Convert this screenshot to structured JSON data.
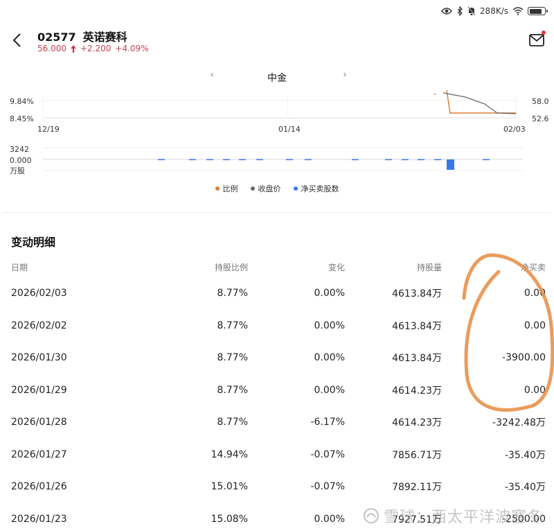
{
  "status_bar": {
    "speed": "288K/s",
    "battery_level": 0.85
  },
  "stock": {
    "code": "02577",
    "name": "英诺赛科",
    "price": "56.000",
    "change": "+2.200",
    "change_pct": "+4.09%"
  },
  "broker": {
    "label": "中金",
    "prev_glyph": "‹",
    "next_glyph": "›"
  },
  "chart": {
    "left_ticks": [
      "9.84%",
      "8.45%"
    ],
    "right_ticks": [
      "58.0",
      "52.6"
    ],
    "x_ticks": [
      "12/19",
      "01/14",
      "02/03"
    ],
    "bar_ticks": [
      "3242",
      "0.000",
      "万股"
    ]
  },
  "chart_data": {
    "type": "line",
    "x": [
      "12/19",
      "01/14",
      "02/03"
    ],
    "series": [
      {
        "name": "比例",
        "color": "#d9803a"
      },
      {
        "name": "收盘价",
        "color": "#666666"
      },
      {
        "name": "净买卖股数",
        "color": "#3b78e7"
      }
    ],
    "left_axis_ticks": [
      "9.84%",
      "8.45%"
    ],
    "right_axis_ticks": [
      "58.0",
      "52.6"
    ],
    "bar_axis_ticks": [
      "3242",
      "0.000"
    ],
    "bar_axis_unit": "万股"
  },
  "legend": [
    {
      "label": "比例",
      "color": "#d9803a"
    },
    {
      "label": "收盘价",
      "color": "#666666"
    },
    {
      "label": "净买卖股数",
      "color": "#3b78e7"
    }
  ],
  "table": {
    "title": "变动明细",
    "headers": {
      "date": "日期",
      "ratio": "持股比例",
      "change": "变化",
      "holding": "持股量",
      "net": "净买卖"
    },
    "rows": [
      {
        "date": "2026/02/03",
        "ratio": "8.77%",
        "change": "0.00%",
        "holding": "4613.84万",
        "net": "0.00"
      },
      {
        "date": "2026/02/02",
        "ratio": "8.77%",
        "change": "0.00%",
        "holding": "4613.84万",
        "net": "0.00"
      },
      {
        "date": "2026/01/30",
        "ratio": "8.77%",
        "change": "0.00%",
        "holding": "4613.84万",
        "net": "-3900.00"
      },
      {
        "date": "2026/01/29",
        "ratio": "8.77%",
        "change": "0.00%",
        "holding": "4614.23万",
        "net": "0.00"
      },
      {
        "date": "2026/01/28",
        "ratio": "8.77%",
        "change": "-6.17%",
        "holding": "4614.23万",
        "net": "-3242.48万"
      },
      {
        "date": "2026/01/27",
        "ratio": "14.94%",
        "change": "-0.07%",
        "holding": "7856.71万",
        "net": "-35.40万"
      },
      {
        "date": "2026/01/26",
        "ratio": "15.01%",
        "change": "-0.07%",
        "holding": "7892.11万",
        "net": "-35.40万"
      },
      {
        "date": "2026/01/23",
        "ratio": "15.08%",
        "change": "0.00%",
        "holding": "7927.51万",
        "net": "-2500.00"
      }
    ]
  },
  "watermark": {
    "text": "雪球：西太平洋波塞冬"
  },
  "colors": {
    "up": "#c8414a",
    "ratio_line": "#d9803a",
    "price_line": "#666666",
    "bar": "#3b78e7",
    "annotation": "#e8914a"
  }
}
